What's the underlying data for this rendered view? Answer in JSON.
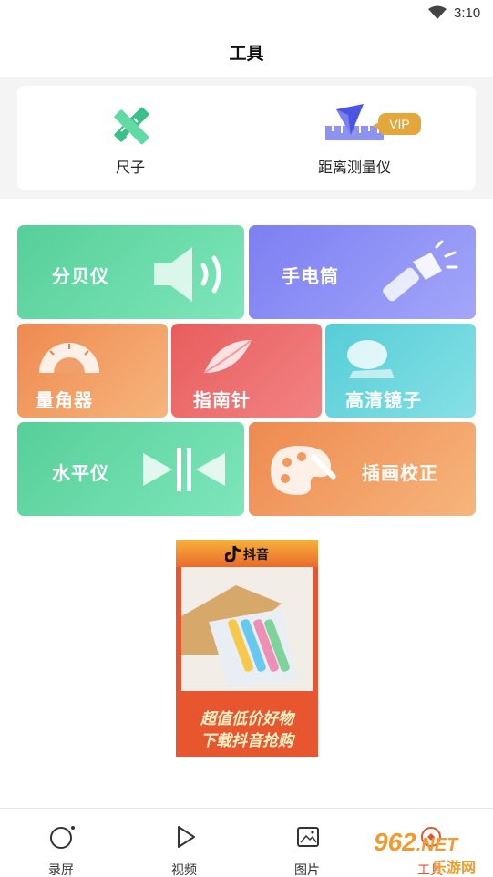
{
  "status_bar": {
    "time": "3:10"
  },
  "header": {
    "title": "工具"
  },
  "top_tools": [
    {
      "label": "尺子",
      "icon": "ruler-icon"
    },
    {
      "label": "距离测量仪",
      "icon": "distance-measure-icon",
      "badge": "VIP"
    }
  ],
  "tiles": [
    {
      "label": "分贝仪",
      "icon": "speaker-icon",
      "color": "#5fd6a3"
    },
    {
      "label": "手电筒",
      "icon": "flashlight-icon",
      "color": "#8a8cf5"
    },
    {
      "label": "量角器",
      "icon": "protractor-icon",
      "color": "#f0995c"
    },
    {
      "label": "指南针",
      "icon": "compass-icon",
      "color": "#ec6b6b"
    },
    {
      "label": "高清镜子",
      "icon": "mirror-icon",
      "color": "#5fd1d9"
    },
    {
      "label": "水平仪",
      "icon": "level-icon",
      "color": "#5fd6a3"
    },
    {
      "label": "插画校正",
      "icon": "palette-icon",
      "color": "#f0995c"
    }
  ],
  "ad": {
    "brand": "抖音",
    "line1": "超值低价好物",
    "line2": "下载抖音抢购"
  },
  "bottom_nav": [
    {
      "label": "录屏",
      "icon": "record-icon"
    },
    {
      "label": "视频",
      "icon": "play-icon"
    },
    {
      "label": "图片",
      "icon": "image-icon"
    },
    {
      "label": "工具",
      "icon": "tools-icon",
      "active": true
    }
  ],
  "watermark": {
    "text": "962",
    "suffix": ".NET",
    "sub": "乐游网"
  },
  "colors": {
    "accent": "#e5532f",
    "vip": "#e3a73b"
  }
}
